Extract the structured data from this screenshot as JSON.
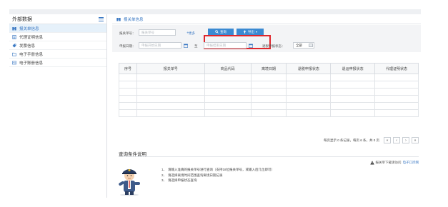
{
  "sidebar": {
    "title": "外部数据",
    "items": [
      {
        "label": "报关单信息",
        "icon": "binoculars-icon",
        "active": true
      },
      {
        "label": "代理证明信息",
        "icon": "document-icon",
        "active": false
      },
      {
        "label": "发票信息",
        "icon": "tag-icon",
        "active": false
      },
      {
        "label": "电子手册信息",
        "icon": "folder-icon",
        "active": false
      },
      {
        "label": "电子账册信息",
        "icon": "id-card-icon",
        "active": false
      }
    ]
  },
  "breadcrumb": {
    "label": "报关单信息"
  },
  "search": {
    "declaration_no_label": "报关单号：",
    "declaration_no_placeholder": "报关单号",
    "more_label": "更多",
    "query_button": "查询",
    "export_button": "导出",
    "start_date_label": "申报日期：",
    "start_date_placeholder": "申报开始日期",
    "to_label": "至",
    "end_date_placeholder": "申报结束日期",
    "status_label": "退税申报状态：",
    "status_value": "全部"
  },
  "table": {
    "headers": [
      "序号",
      "报关单号",
      "商品代码",
      "离境日期",
      "退税申报状态",
      "退运申报状态",
      "代理证明状态"
    ],
    "empty_rows": 6
  },
  "pager": {
    "info": "每页显示 0 条记录，每页 6 条，共 0 页",
    "first": "«",
    "prev": "‹",
    "next": "›",
    "last": "»"
  },
  "help": {
    "title": "查询条件说明",
    "download_prefix": "报关单下载请访问",
    "download_link": "电子口岸网",
    "notes": [
      "请输入准确的报关单号进行查询（支持18位报关单号，或输入后几位即可）",
      "请选择离境时间范围查询离境日期记录",
      "请选择申报状态查询"
    ]
  },
  "colors": {
    "accent": "#3b8ad2",
    "highlight": "#e0262c",
    "sidebar_active": "#e6f1fa"
  }
}
